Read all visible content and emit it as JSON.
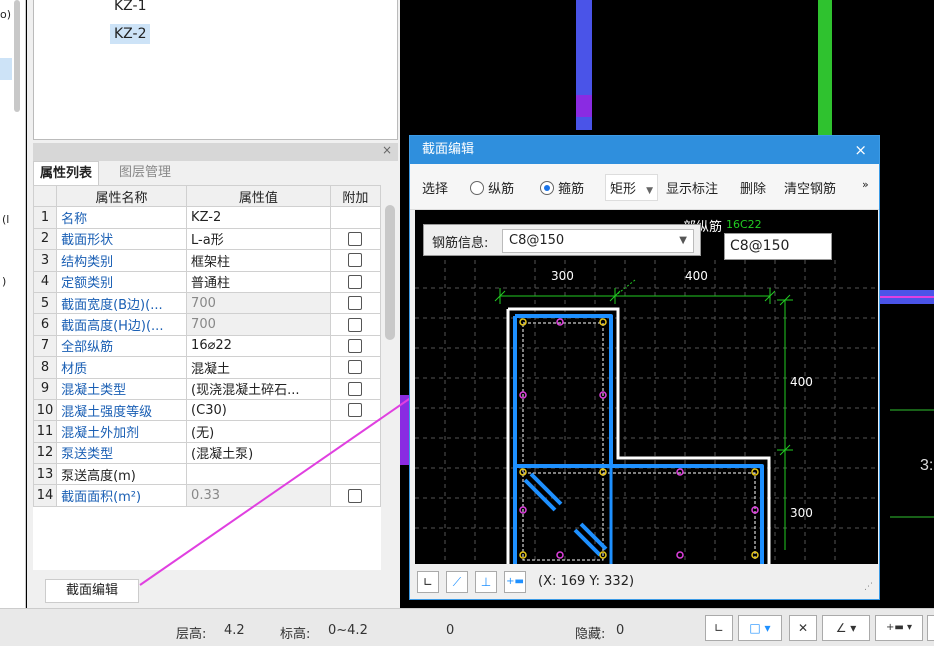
{
  "left_strip": {
    "labels": [
      "o)",
      "(l",
      ")"
    ]
  },
  "component_list": {
    "items": [
      "KZ-1",
      "KZ-2"
    ],
    "selected": "KZ-2"
  },
  "tabs": {
    "properties": "属性列表",
    "layers": "图层管理"
  },
  "table": {
    "headers": [
      "",
      "属性名称",
      "属性值",
      "附加"
    ],
    "rows": [
      {
        "idx": "1",
        "name": "名称",
        "value": "KZ-2",
        "checkbox": false,
        "blue": true,
        "gray": false
      },
      {
        "idx": "2",
        "name": "截面形状",
        "value": "L-a形",
        "checkbox": true,
        "blue": true,
        "gray": false
      },
      {
        "idx": "3",
        "name": "结构类别",
        "value": "框架柱",
        "checkbox": true,
        "blue": true,
        "gray": false
      },
      {
        "idx": "4",
        "name": "定额类别",
        "value": "普通柱",
        "checkbox": true,
        "blue": true,
        "gray": false
      },
      {
        "idx": "5",
        "name": "截面宽度(B边)(...",
        "value": "700",
        "checkbox": true,
        "blue": true,
        "gray": true
      },
      {
        "idx": "6",
        "name": "截面高度(H边)(...",
        "value": "700",
        "checkbox": true,
        "blue": true,
        "gray": true
      },
      {
        "idx": "7",
        "name": "全部纵筋",
        "value": "16⌀22",
        "checkbox": true,
        "blue": true,
        "gray": false
      },
      {
        "idx": "8",
        "name": "材质",
        "value": "混凝土",
        "checkbox": true,
        "blue": true,
        "gray": false
      },
      {
        "idx": "9",
        "name": "混凝土类型",
        "value": "(现浇混凝土碎石...",
        "checkbox": true,
        "blue": true,
        "gray": false
      },
      {
        "idx": "10",
        "name": "混凝土强度等级",
        "value": "(C30)",
        "checkbox": true,
        "blue": true,
        "gray": false
      },
      {
        "idx": "11",
        "name": "混凝土外加剂",
        "value": "(无)",
        "checkbox": false,
        "blue": true,
        "gray": false
      },
      {
        "idx": "12",
        "name": "泵送类型",
        "value": "(混凝土泵)",
        "checkbox": false,
        "blue": true,
        "gray": false
      },
      {
        "idx": "13",
        "name": "泵送高度(m)",
        "value": "",
        "checkbox": false,
        "blue": false,
        "gray": false
      },
      {
        "idx": "14",
        "name": "截面面积(m²)",
        "value": "0.33",
        "checkbox": true,
        "blue": true,
        "gray": true
      }
    ]
  },
  "section_edit_button": "截面编辑",
  "status": {
    "floor_height_label": "层高:",
    "floor_height": "4.2",
    "elevation_label": "标高:",
    "elevation": "0~4.2",
    "count": "0",
    "hidden_label": "隐藏:",
    "hidden": "0"
  },
  "dialog": {
    "title": "截面编辑",
    "close": "×",
    "toolbar": {
      "select": "选择",
      "longitudinal": "纵筋",
      "stirrup": "箍筋",
      "shape": "矩形",
      "show_label": "显示标注",
      "delete": "删除",
      "clear": "清空钢筋",
      "more": "»"
    },
    "rebar_info_label": "钢筋信息:",
    "rebar_info_value": "C8@150",
    "info_input_value": "C8@150",
    "canvas_texts": {
      "dim_300_top": "300",
      "dim_400_top": "400",
      "dim_400_right": "400",
      "dim_300_right": "300",
      "label_long": "部纵筋",
      "label_green": "16C22",
      "label_fen": "筋"
    },
    "coord": "(X: 169 Y: 332)"
  },
  "right_text": "3:",
  "colors": {
    "accent": "#2f8fdd",
    "rebar_blue": "#1e90ff",
    "dim_green": "#22cc22",
    "annot_magenta": "#e040e0",
    "cad_green": "#2fc22f",
    "cad_blue": "#4a54e8"
  }
}
